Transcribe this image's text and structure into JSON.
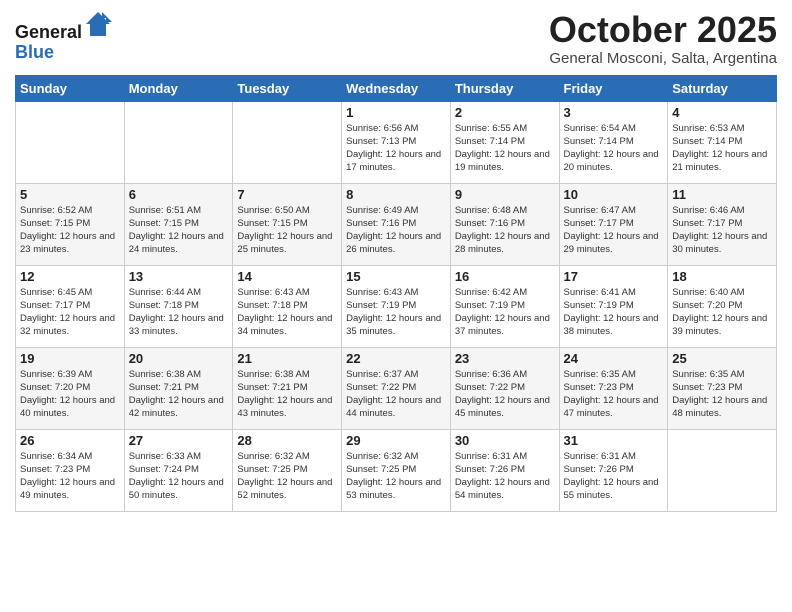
{
  "logo": {
    "general": "General",
    "blue": "Blue"
  },
  "header": {
    "month": "October 2025",
    "location": "General Mosconi, Salta, Argentina"
  },
  "days_of_week": [
    "Sunday",
    "Monday",
    "Tuesday",
    "Wednesday",
    "Thursday",
    "Friday",
    "Saturday"
  ],
  "weeks": [
    [
      {
        "day": "",
        "info": ""
      },
      {
        "day": "",
        "info": ""
      },
      {
        "day": "",
        "info": ""
      },
      {
        "day": "1",
        "info": "Sunrise: 6:56 AM\nSunset: 7:13 PM\nDaylight: 12 hours\nand 17 minutes."
      },
      {
        "day": "2",
        "info": "Sunrise: 6:55 AM\nSunset: 7:14 PM\nDaylight: 12 hours\nand 19 minutes."
      },
      {
        "day": "3",
        "info": "Sunrise: 6:54 AM\nSunset: 7:14 PM\nDaylight: 12 hours\nand 20 minutes."
      },
      {
        "day": "4",
        "info": "Sunrise: 6:53 AM\nSunset: 7:14 PM\nDaylight: 12 hours\nand 21 minutes."
      }
    ],
    [
      {
        "day": "5",
        "info": "Sunrise: 6:52 AM\nSunset: 7:15 PM\nDaylight: 12 hours\nand 23 minutes."
      },
      {
        "day": "6",
        "info": "Sunrise: 6:51 AM\nSunset: 7:15 PM\nDaylight: 12 hours\nand 24 minutes."
      },
      {
        "day": "7",
        "info": "Sunrise: 6:50 AM\nSunset: 7:15 PM\nDaylight: 12 hours\nand 25 minutes."
      },
      {
        "day": "8",
        "info": "Sunrise: 6:49 AM\nSunset: 7:16 PM\nDaylight: 12 hours\nand 26 minutes."
      },
      {
        "day": "9",
        "info": "Sunrise: 6:48 AM\nSunset: 7:16 PM\nDaylight: 12 hours\nand 28 minutes."
      },
      {
        "day": "10",
        "info": "Sunrise: 6:47 AM\nSunset: 7:17 PM\nDaylight: 12 hours\nand 29 minutes."
      },
      {
        "day": "11",
        "info": "Sunrise: 6:46 AM\nSunset: 7:17 PM\nDaylight: 12 hours\nand 30 minutes."
      }
    ],
    [
      {
        "day": "12",
        "info": "Sunrise: 6:45 AM\nSunset: 7:17 PM\nDaylight: 12 hours\nand 32 minutes."
      },
      {
        "day": "13",
        "info": "Sunrise: 6:44 AM\nSunset: 7:18 PM\nDaylight: 12 hours\nand 33 minutes."
      },
      {
        "day": "14",
        "info": "Sunrise: 6:43 AM\nSunset: 7:18 PM\nDaylight: 12 hours\nand 34 minutes."
      },
      {
        "day": "15",
        "info": "Sunrise: 6:43 AM\nSunset: 7:19 PM\nDaylight: 12 hours\nand 35 minutes."
      },
      {
        "day": "16",
        "info": "Sunrise: 6:42 AM\nSunset: 7:19 PM\nDaylight: 12 hours\nand 37 minutes."
      },
      {
        "day": "17",
        "info": "Sunrise: 6:41 AM\nSunset: 7:19 PM\nDaylight: 12 hours\nand 38 minutes."
      },
      {
        "day": "18",
        "info": "Sunrise: 6:40 AM\nSunset: 7:20 PM\nDaylight: 12 hours\nand 39 minutes."
      }
    ],
    [
      {
        "day": "19",
        "info": "Sunrise: 6:39 AM\nSunset: 7:20 PM\nDaylight: 12 hours\nand 40 minutes."
      },
      {
        "day": "20",
        "info": "Sunrise: 6:38 AM\nSunset: 7:21 PM\nDaylight: 12 hours\nand 42 minutes."
      },
      {
        "day": "21",
        "info": "Sunrise: 6:38 AM\nSunset: 7:21 PM\nDaylight: 12 hours\nand 43 minutes."
      },
      {
        "day": "22",
        "info": "Sunrise: 6:37 AM\nSunset: 7:22 PM\nDaylight: 12 hours\nand 44 minutes."
      },
      {
        "day": "23",
        "info": "Sunrise: 6:36 AM\nSunset: 7:22 PM\nDaylight: 12 hours\nand 45 minutes."
      },
      {
        "day": "24",
        "info": "Sunrise: 6:35 AM\nSunset: 7:23 PM\nDaylight: 12 hours\nand 47 minutes."
      },
      {
        "day": "25",
        "info": "Sunrise: 6:35 AM\nSunset: 7:23 PM\nDaylight: 12 hours\nand 48 minutes."
      }
    ],
    [
      {
        "day": "26",
        "info": "Sunrise: 6:34 AM\nSunset: 7:23 PM\nDaylight: 12 hours\nand 49 minutes."
      },
      {
        "day": "27",
        "info": "Sunrise: 6:33 AM\nSunset: 7:24 PM\nDaylight: 12 hours\nand 50 minutes."
      },
      {
        "day": "28",
        "info": "Sunrise: 6:32 AM\nSunset: 7:25 PM\nDaylight: 12 hours\nand 52 minutes."
      },
      {
        "day": "29",
        "info": "Sunrise: 6:32 AM\nSunset: 7:25 PM\nDaylight: 12 hours\nand 53 minutes."
      },
      {
        "day": "30",
        "info": "Sunrise: 6:31 AM\nSunset: 7:26 PM\nDaylight: 12 hours\nand 54 minutes."
      },
      {
        "day": "31",
        "info": "Sunrise: 6:31 AM\nSunset: 7:26 PM\nDaylight: 12 hours\nand 55 minutes."
      },
      {
        "day": "",
        "info": ""
      }
    ]
  ]
}
